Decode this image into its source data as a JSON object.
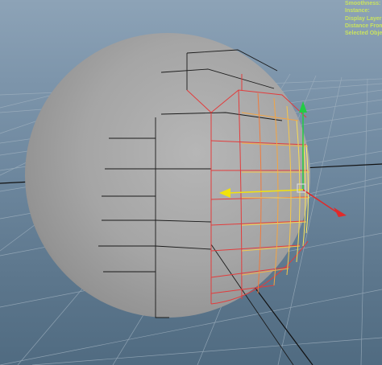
{
  "hud": {
    "rows": [
      {
        "label": "Smoothness:"
      },
      {
        "label": "Instance:"
      },
      {
        "label": "Display Layer:"
      },
      {
        "label": "Distance From C"
      },
      {
        "label": "Selected Object"
      }
    ]
  },
  "scene": {
    "object": "polygon-sphere",
    "selection": "half-sphere-faces",
    "manipulator": "move-tool",
    "grid": true
  },
  "colors": {
    "sphere": "#a9a9a9",
    "selection_edges": "#ffe15a",
    "selection_outline": "#e83a3a",
    "grid": "#1a1a1a",
    "gizmo_x": "#e02a2a",
    "gizmo_y": "#2ad14a",
    "gizmo_z": "#f2e20c",
    "hud_text": "#c9e25f"
  }
}
